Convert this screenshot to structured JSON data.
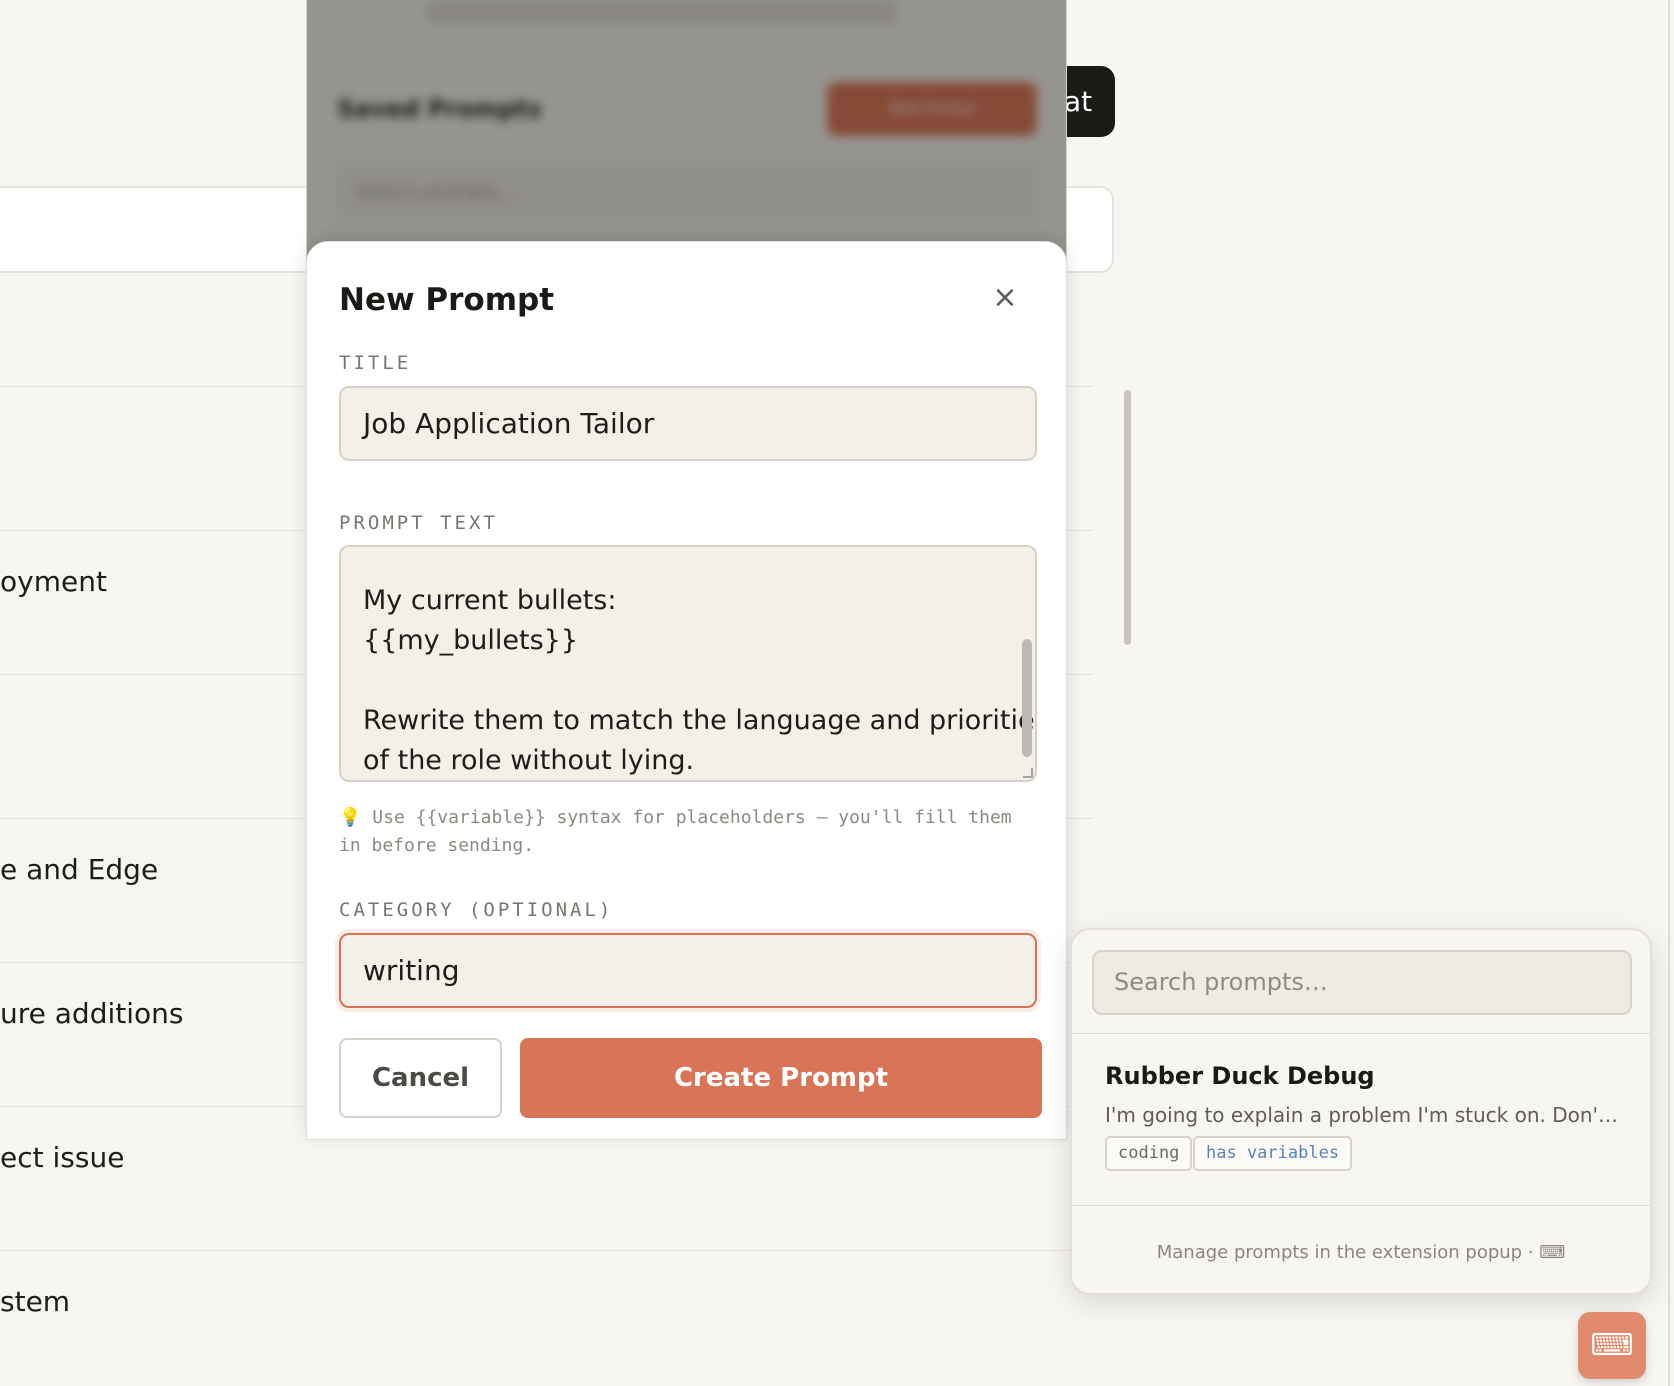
{
  "background": {
    "top_right_button_fragment": "at",
    "rows": [
      {
        "label": ""
      },
      {
        "label": ""
      },
      {
        "label": "oyment"
      },
      {
        "label": ""
      },
      {
        "label": "e and Edge"
      },
      {
        "label": "ure additions"
      },
      {
        "label": "ect issue"
      },
      {
        "label": "stem"
      }
    ]
  },
  "extension_popup": {
    "heading": "Saved Prompts",
    "new_button_label": "New Prompt",
    "search_placeholder": "Search prompts..."
  },
  "modal": {
    "title": "New Prompt",
    "close_glyph": "×",
    "title_label": "TITLE",
    "title_value": "Job Application Tailor",
    "prompt_label": "PROMPT TEXT",
    "prompt_lines": [
      "My current bullets:",
      "{{my_bullets}}",
      "",
      "Rewrite them to match the language and priorities",
      "of the role without lying."
    ],
    "hint_icon": "lightbulb-icon",
    "hint_text": "Use {{variable}} syntax for placeholders — you'll fill them in before sending.",
    "category_label": "CATEGORY (OPTIONAL)",
    "category_value": "writing",
    "cancel_label": "Cancel",
    "create_label": "Create Prompt"
  },
  "picker": {
    "search_placeholder": "Search prompts…",
    "items": [
      {
        "title": "Rubber Duck Debug",
        "description": "I'm going to explain a problem I'm stuck on. Don't giv…",
        "tags": [
          "coding",
          "has variables"
        ]
      }
    ],
    "footer": "Manage prompts in the extension popup · ⌨"
  },
  "fab_icon": "keyboard-icon",
  "colors": {
    "accent": "#d97557",
    "focus_border": "#d87356",
    "tag_blue": "#5b82b4"
  }
}
